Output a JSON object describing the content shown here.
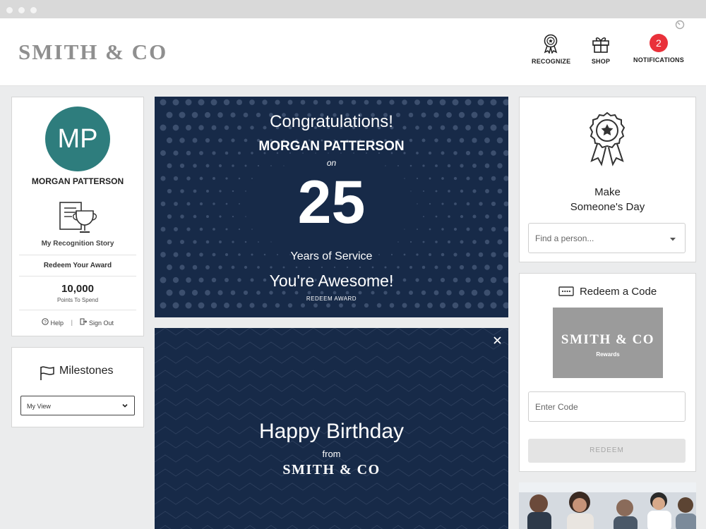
{
  "header": {
    "logo": "SMITH & CO",
    "nav": {
      "recognize": "RECOGNIZE",
      "shop": "SHOP",
      "notifications": "NOTIFICATIONS",
      "notification_count": "2"
    }
  },
  "profile": {
    "initials": "MP",
    "name": "MORGAN PATTERSON",
    "story_link": "My Recognition Story",
    "redeem_award_link": "Redeem Your Award",
    "points_value": "10,000",
    "points_label": "Points To Spend",
    "help_link": "Help",
    "signout_link": "Sign Out"
  },
  "milestones": {
    "title": "Milestones",
    "view_select": "My View"
  },
  "anniversary": {
    "congrats": "Congratulations!",
    "name": "MORGAN PATTERSON",
    "on": "on",
    "years": "25",
    "years_label": "Years of Service",
    "awesome": "You're Awesome!",
    "redeem": "REDEEM AWARD"
  },
  "birthday": {
    "title": "Happy Birthday",
    "from": "from",
    "company": "SMITH & CO"
  },
  "recognize_card": {
    "title_line1": "Make",
    "title_line2": "Someone's Day",
    "search_placeholder": "Find a person..."
  },
  "redeem_code": {
    "title": "Redeem a Code",
    "card_logo": "SMITH & CO",
    "card_sub": "Rewards",
    "code_placeholder": "Enter Code",
    "button": "REDEEM"
  },
  "colors": {
    "brand_navy": "#172a48",
    "avatar_teal": "#2e7d7d",
    "badge_red": "#e9313a"
  }
}
